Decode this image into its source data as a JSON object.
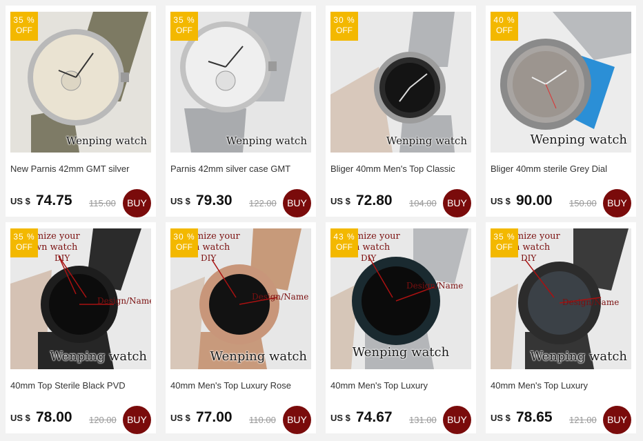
{
  "colors": {
    "badge": "#f3b800",
    "buy_button": "#7a0b0b",
    "old_price": "#999999",
    "background": "#f2f2f2"
  },
  "products": [
    {
      "discount": "35 %",
      "off": "OFF",
      "title": "New Parnis 42mm GMT silver",
      "currency": "US $",
      "price": "74.75",
      "old_price": "115.00",
      "buy": "BUY",
      "watermark": "Wenping watch"
    },
    {
      "discount": "35 %",
      "off": "OFF",
      "title": "Parnis 42mm silver case GMT",
      "currency": "US $",
      "price": "79.30",
      "old_price": "122.00",
      "buy": "BUY",
      "watermark": "Wenping watch"
    },
    {
      "discount": "30 %",
      "off": "OFF",
      "title": "Bliger 40mm Men's Top Classic",
      "currency": "US $",
      "price": "72.80",
      "old_price": "104.00",
      "buy": "BUY",
      "watermark": "Wenping watch"
    },
    {
      "discount": "40 %",
      "off": "OFF",
      "title": "Bliger 40mm sterile Grey Dial",
      "currency": "US $",
      "price": "90.00",
      "old_price": "150.00",
      "buy": "BUY",
      "watermark": "Wenping watch"
    },
    {
      "discount": "35 %",
      "off": "OFF",
      "title": "40mm Top Sterile Black PVD",
      "currency": "US $",
      "price": "78.00",
      "old_price": "120.00",
      "buy": "BUY",
      "watermark": "Wenping watch",
      "overlay": [
        "omize your",
        "wn watch",
        "DIY",
        "Design/Name"
      ]
    },
    {
      "discount": "30 %",
      "off": "OFF",
      "title": "40mm Men's Top Luxury Rose",
      "currency": "US $",
      "price": "77.00",
      "old_price": "110.00",
      "buy": "BUY",
      "watermark": "Wenping watch",
      "overlay": [
        "omize your",
        "n watch",
        "DIY",
        "Design/Name"
      ]
    },
    {
      "discount": "43 %",
      "off": "OFF",
      "title": "40mm Men's Top Luxury",
      "currency": "US $",
      "price": "74.67",
      "old_price": "131.00",
      "buy": "BUY",
      "watermark": "Wenping watch",
      "overlay": [
        "omize your",
        "n watch",
        "DIY",
        "Design/Name"
      ]
    },
    {
      "discount": "35 %",
      "off": "OFF",
      "title": "40mm Men's Top Luxury",
      "currency": "US $",
      "price": "78.65",
      "old_price": "121.00",
      "buy": "BUY",
      "watermark": "Wenping watch",
      "overlay": [
        "omize your",
        "n watch",
        "DIY",
        "Design/Name"
      ]
    }
  ]
}
